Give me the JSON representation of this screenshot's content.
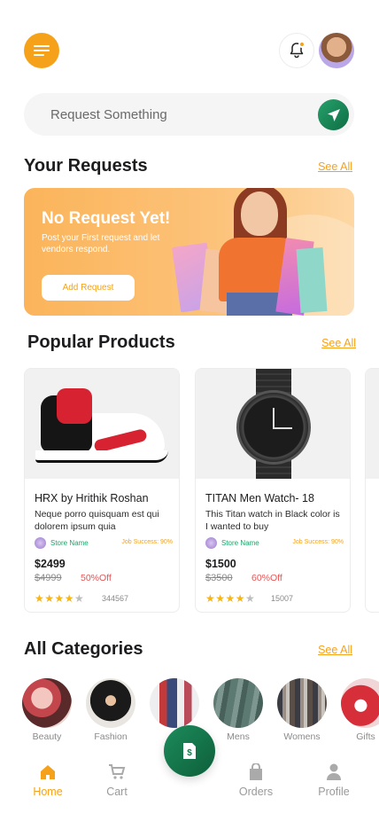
{
  "search": {
    "placeholder": "Request Something"
  },
  "requests": {
    "title": "Your Requests",
    "see_all": "See All",
    "banner": {
      "title": "No Request Yet!",
      "subtitle": "Post your First request and let vendors respond.",
      "button": "Add Request"
    }
  },
  "popular": {
    "title": "Popular Products",
    "see_all": "See All",
    "products": [
      {
        "title": "HRX by Hrithik Roshan",
        "desc": "Neque porro quisquam est qui dolorem ipsum quia",
        "store": "Store Name",
        "job_success": "Job Success: 90%",
        "price": "$2499",
        "old_price": "$4999",
        "off": "50%Off",
        "rating": 4,
        "reviews": "344567"
      },
      {
        "title": "TITAN Men Watch- 18",
        "desc": "This Titan watch in Black color is I wanted to buy",
        "store": "Store Name",
        "job_success": "Job Success: 90%",
        "price": "$1500",
        "old_price": "$3500",
        "off": "60%Off",
        "rating": 4,
        "reviews": "15007"
      }
    ]
  },
  "categories": {
    "title": "All Categories",
    "see_all": "See All",
    "items": [
      "Beauty",
      "Fashion",
      "",
      "Mens",
      "Womens",
      "Gifts"
    ]
  },
  "nav": {
    "home": "Home",
    "cart": "Cart",
    "orders": "Orders",
    "profile": "Profile",
    "fab_symbol": "$"
  },
  "colors": {
    "accent": "#f5a21a",
    "green": "#1ba468"
  },
  "icons": [
    "menu-icon",
    "bell-icon",
    "send-icon",
    "home-icon",
    "cart-icon",
    "orders-icon",
    "profile-icon",
    "dollar-icon",
    "star-icon"
  ]
}
